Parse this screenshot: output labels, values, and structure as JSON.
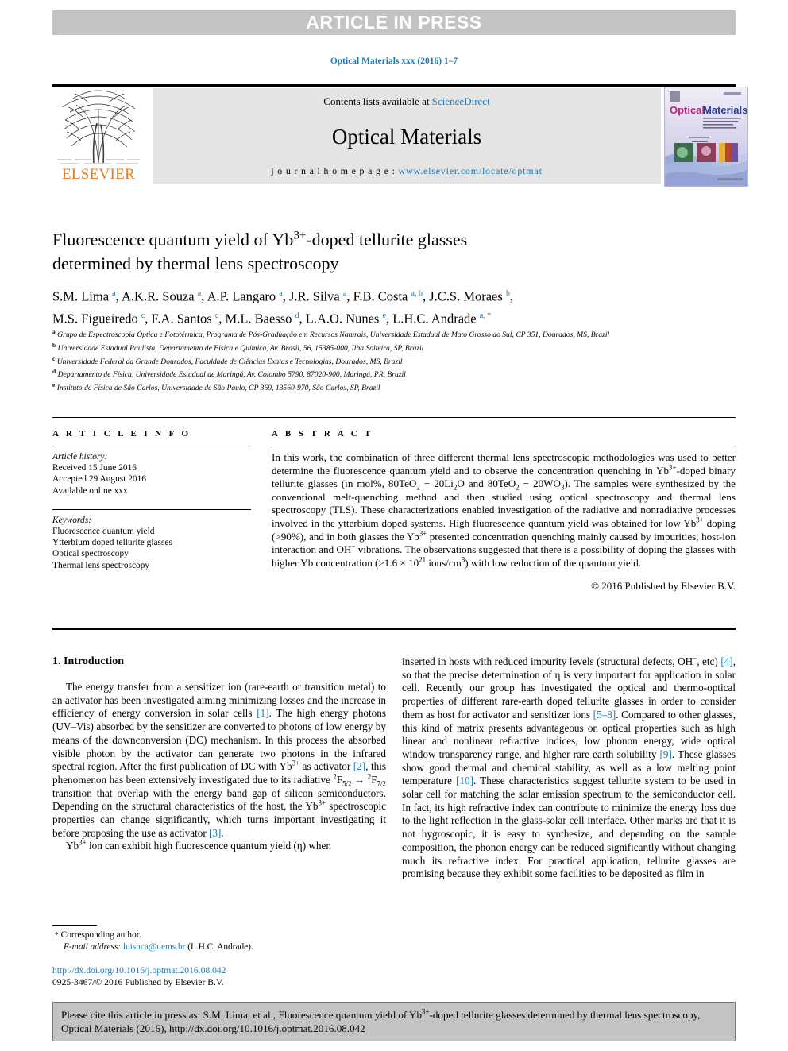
{
  "banner": {
    "text": "ARTICLE IN PRESS"
  },
  "running_head": {
    "text": "Optical Materials xxx (2016) 1–7"
  },
  "masthead": {
    "contents_prefix": "Contents lists available at ",
    "contents_link": "ScienceDirect",
    "journal_name": "Optical Materials",
    "homepage_label": "j o u r n a l   h o m e p a g e :  ",
    "homepage_url": "www.elsevier.com/locate/optmat",
    "publisher_name": "ELSEVIER",
    "cover_title_1": "Optical",
    "cover_title_2": "Materials"
  },
  "article": {
    "title": "Fluorescence quantum yield of Yb3+-doped tellurite glasses determined by thermal lens spectroscopy",
    "title_parts": {
      "line1_a": "Fluorescence quantum yield of Yb",
      "line1_sup": "3+",
      "line1_b": "-doped tellurite glasses",
      "line2": "determined by thermal lens spectroscopy"
    },
    "authors": [
      {
        "name": "S.M. Lima",
        "marks": "a"
      },
      {
        "name": "A.K.R. Souza",
        "marks": "a"
      },
      {
        "name": "A.P. Langaro",
        "marks": "a"
      },
      {
        "name": "J.R. Silva",
        "marks": "a"
      },
      {
        "name": "F.B. Costa",
        "marks": "a, b"
      },
      {
        "name": "J.C.S. Moraes",
        "marks": "b"
      },
      {
        "name": "M.S. Figueiredo",
        "marks": "c"
      },
      {
        "name": "F.A. Santos",
        "marks": "c"
      },
      {
        "name": "M.L. Baesso",
        "marks": "d"
      },
      {
        "name": "L.A.O. Nunes",
        "marks": "e"
      },
      {
        "name": "L.H.C. Andrade",
        "marks": "a, *"
      }
    ],
    "affiliations": [
      {
        "mark": "a",
        "text": "Grupo de Espectroscopia Óptica e Fototérmica, Programa de Pós-Graduação em Recursos Naturais, Universidade Estadual de Mato Grosso do Sul, CP 351, Dourados, MS, Brazil"
      },
      {
        "mark": "b",
        "text": "Universidade Estadual Paulista, Departamento de Física e Química, Av. Brasil, 56, 15385-000, Ilha Solteira, SP, Brazil"
      },
      {
        "mark": "c",
        "text": "Universidade Federal da Grande Dourados, Faculdade de Ciências Exatas e Tecnologias, Dourados, MS, Brazil"
      },
      {
        "mark": "d",
        "text": "Departamento de Física, Universidade Estadual de Maringá, Av. Colombo 5790, 87020-900, Maringá, PR, Brazil"
      },
      {
        "mark": "e",
        "text": "Instituto de Física de São Carlos, Universidade de São Paulo, CP 369, 13560-970, São Carlos, SP, Brazil"
      }
    ]
  },
  "article_info": {
    "heading": "A R T I C L E   I N F O",
    "history_label": "Article history:",
    "history": [
      "Received 15 June 2016",
      "Accepted 29 August 2016",
      "Available online xxx"
    ],
    "keywords_label": "Keywords:",
    "keywords": [
      "Fluorescence quantum yield",
      "Ytterbium doped tellurite glasses",
      "Optical spectroscopy",
      "Thermal lens spectroscopy"
    ]
  },
  "abstract": {
    "heading": "A B S T R A C T",
    "p1_a": "In this work, the combination of three different thermal lens spectroscopic methodologies was used to better determine the fluorescence quantum yield and to observe the concentration quenching in Yb",
    "p1_sup1": "3+",
    "p1_b": "-doped binary tellurite glasses (in mol%, 80TeO",
    "p1_sub1": "2",
    "p1_c": " − 20Li",
    "p1_sub2": "2",
    "p1_d": "O and 80TeO",
    "p1_sub3": "2",
    "p1_e": " − 20WO",
    "p1_sub4": "3",
    "p1_f": "). The samples were synthesized by the conventional melt-quenching method and then studied using optical spectroscopy and thermal lens spectroscopy (TLS). These characterizations enabled investigation of the radiative and nonradiative processes involved in the ytterbium doped systems. High fluorescence quantum yield was obtained for low Yb",
    "p1_sup2": "3+",
    "p1_g": " doping (>90%), and in both glasses the Yb",
    "p1_sup3": "3+",
    "p1_h": " presented concentration quenching mainly caused by impurities, host-ion interaction and OH",
    "p1_sup4": "−",
    "p1_i": " vibrations. The observations suggested that there is a possibility of doping the glasses with higher Yb concentration (>1.6 × 10",
    "p1_sup5": "21",
    "p1_j": " ions/cm",
    "p1_sup6": "3",
    "p1_k": ") with low reduction of the quantum yield.",
    "copyright": "© 2016 Published by Elsevier B.V."
  },
  "body": {
    "section_1_title": "1.  Introduction",
    "left_p1_a": "The energy transfer from a sensitizer ion (rare-earth or transition metal) to an activator has been investigated aiming minimizing losses and the increase in efficiency of energy conversion in solar cells ",
    "left_p1_ref1": "[1]",
    "left_p1_b": ". The high energy photons (UV–Vis) absorbed by the sensitizer are converted to photons of low energy by means of the downconversion (DC) mechanism. In this process the absorbed visible photon by the activator can generate two photons in the infrared spectral region. After the first publication of DC with Yb",
    "left_p1_sup1": "3+",
    "left_p1_c": " as activator ",
    "left_p1_ref2": "[2]",
    "left_p1_d": ", this phenomenon has been extensively investigated due to its radiative ",
    "left_p1_trans_a": "2",
    "left_p1_trans_b": "F",
    "left_p1_trans_c": "5/2",
    "left_p1_trans_arrow": " → ",
    "left_p1_trans_d": "2",
    "left_p1_trans_e": "F",
    "left_p1_trans_f": "7/2",
    "left_p1_e": " transition that overlap with the energy band gap of silicon semiconductors. Depending on the structural characteristics of the host, the Yb",
    "left_p1_sup2": "3+",
    "left_p1_f": " spectroscopic properties can change significantly, which turns important investigating it before proposing the use as activator ",
    "left_p1_ref3": "[3]",
    "left_p1_g": ".",
    "left_p2_a": "Yb",
    "left_p2_sup": "3+",
    "left_p2_b": " ion can exhibit high fluorescence quantum yield (η) when",
    "right_p_a": "inserted in hosts with reduced impurity levels (structural defects, OH",
    "right_p_sup1": "−",
    "right_p_b": ", etc) ",
    "right_p_ref4": "[4]",
    "right_p_c": ", so that the precise determination of η is very important for application in solar cell. Recently our group has investigated the optical and thermo-optical properties of different rare-earth doped tellurite glasses in order to consider them as host for activator and sensitizer ions ",
    "right_p_ref58": "[5–8]",
    "right_p_d": ". Compared to other glasses, this kind of matrix presents advantageous on optical properties such as high linear and nonlinear refractive indices, low phonon energy, wide optical window transparency range, and higher rare earth solubility ",
    "right_p_ref9": "[9]",
    "right_p_e": ". These glasses show good thermal and chemical stability, as well as a low melting point temperature ",
    "right_p_ref10": "[10]",
    "right_p_f": ". These characteristics suggest tellurite system to be used in solar cell for matching the solar emission spectrum to the semiconductor cell. In fact, its high refractive index can contribute to minimize the energy loss due to the light reflection in the glass-solar cell interface. Other marks are that it is not hygroscopic, it is easy to synthesize, and depending on the sample composition, the phonon energy can be reduced significantly without changing much its refractive index. For practical application, tellurite glasses are promising because they exhibit some facilities to be deposited as film in"
  },
  "footer": {
    "corresponding_star": "*",
    "corresponding_label": "Corresponding author.",
    "email_label": "E-mail address:",
    "email": "luishca@uems.br",
    "email_person": "(L.H.C. Andrade).",
    "doi_url": "http://dx.doi.org/10.1016/j.optmat.2016.08.042",
    "issn_line": "0925-3467/© 2016 Published by Elsevier B.V."
  },
  "cite_box": {
    "line_a": "Please cite this article in press as: S.M. Lima, et al., Fluorescence quantum yield of Yb",
    "line_sup": "3+",
    "line_b": "-doped tellurite glasses determined by thermal lens spectroscopy, Optical Materials (2016), http://dx.doi.org/10.1016/j.optmat.2016.08.042"
  },
  "colors": {
    "link": "#1a7bb9",
    "banner_bg": "#c3c3c3",
    "masthead_bg": "#e4e4e4",
    "elsevier_orange": "#e87b22"
  }
}
